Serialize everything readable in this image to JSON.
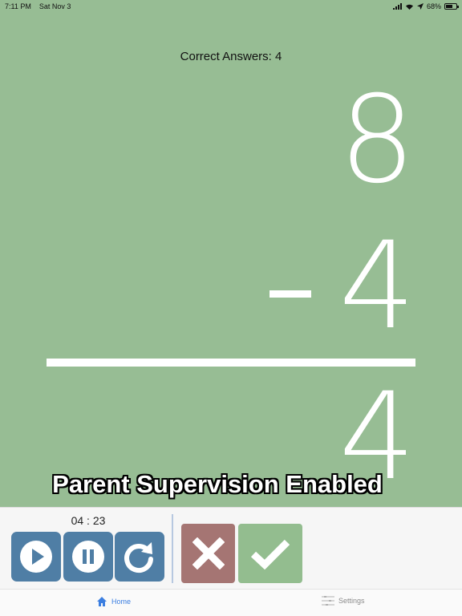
{
  "status_bar": {
    "time": "7:11 PM",
    "date": "Sat Nov 3",
    "battery": "68%",
    "battery_level": 0.68
  },
  "game": {
    "correct_answers": "Correct Answers: 4",
    "top_number": "8",
    "operator": "-",
    "bottom_number": "4",
    "answer": "4",
    "supervision": "Parent Supervision Enabled"
  },
  "timer": {
    "value": "04 : 23"
  },
  "controls": {
    "play_icon": "play-icon",
    "pause_icon": "pause-icon",
    "reset_icon": "reset-icon"
  },
  "answers": {
    "wrong_icon": "x-icon",
    "right_icon": "checkmark-icon"
  },
  "tabs": [
    {
      "label": "Home",
      "icon": "home-icon",
      "active": true
    },
    {
      "label": "Settings",
      "icon": "settings-icon",
      "active": false
    }
  ],
  "colors": {
    "background": "#97bd94",
    "control": "#4f7ea5",
    "wrong": "#a57573",
    "right": "#93bd8f",
    "tab_active": "#3b7ee0"
  }
}
